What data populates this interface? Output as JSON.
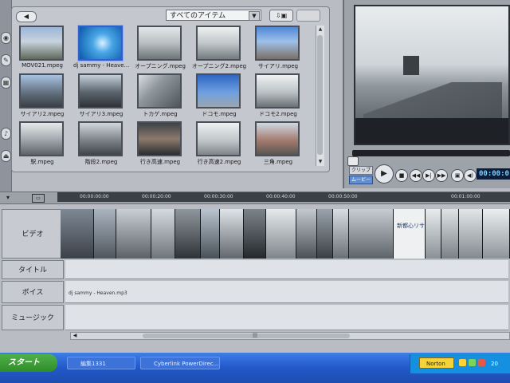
{
  "colors": {
    "accent": "#2f5fd0",
    "taskbar": "#2358c8",
    "start": "#2f8c2a",
    "timecode": "#7fd0ff"
  },
  "left_tools": [
    {
      "icon": "capture-icon",
      "glyph": "◉"
    },
    {
      "icon": "edit-icon",
      "glyph": "✎"
    },
    {
      "icon": "effects-icon",
      "glyph": "▦"
    },
    {
      "icon": "audio-icon",
      "glyph": "♪"
    },
    {
      "icon": "output-icon",
      "glyph": "⏏"
    }
  ],
  "library": {
    "back_label": "◀",
    "filter_value": "すべてのアイテム",
    "filter_arrow": "▼",
    "import_label": "⇩▣",
    "scroll_up": "▲",
    "scroll_down": "▼",
    "clips": [
      {
        "name": "MOV021.mpeg"
      },
      {
        "name": "dj sammy - Heave...",
        "selected": true
      },
      {
        "name": "オープニング.mpeg"
      },
      {
        "name": "オープニング2.mpeg"
      },
      {
        "name": "サイアリ.mpeg"
      },
      {
        "name": "サイアリ2.mpeg"
      },
      {
        "name": "サイアリ3.mpeg"
      },
      {
        "name": "トカゲ.mpeg"
      },
      {
        "name": "ドコモ.mpeg"
      },
      {
        "name": "ドコモ2.mpeg"
      },
      {
        "name": "駅.mpeg"
      },
      {
        "name": "階段2.mpeg"
      },
      {
        "name": "行き高速.mpeg"
      },
      {
        "name": "行き高速2.mpeg"
      },
      {
        "name": "三角.mpeg"
      }
    ]
  },
  "preview": {
    "mode_clip": "クリップ",
    "mode_movie": "ムービー",
    "play": "▶",
    "stop": "■",
    "prev": "◀◀",
    "next": "▶|",
    "ff": "▶▶",
    "snapshot": "▣",
    "volume": "◀)",
    "timecode": "00:00:0"
  },
  "timeline": {
    "ruler_ticks": [
      "00:00:00:00",
      "00:00:20:00",
      "00:00:30:00",
      "00:00:40:00",
      "00:00:50:00",
      "00:01:00:00"
    ],
    "tracks": {
      "video": "ビデオ",
      "title": "タイトル",
      "voice": "ボイス",
      "music": "ミュージック"
    },
    "audio_clip": "dj sammy - Heaven.mp3",
    "title_clip_text": "新都心リサ",
    "scroll_left": "◀",
    "scroll_grip": "|||"
  },
  "taskbar": {
    "start": "スタート",
    "tasks": [
      "編集1331",
      "Cyberlink PowerDirec..."
    ],
    "norton": "Norton",
    "clock": "20"
  }
}
